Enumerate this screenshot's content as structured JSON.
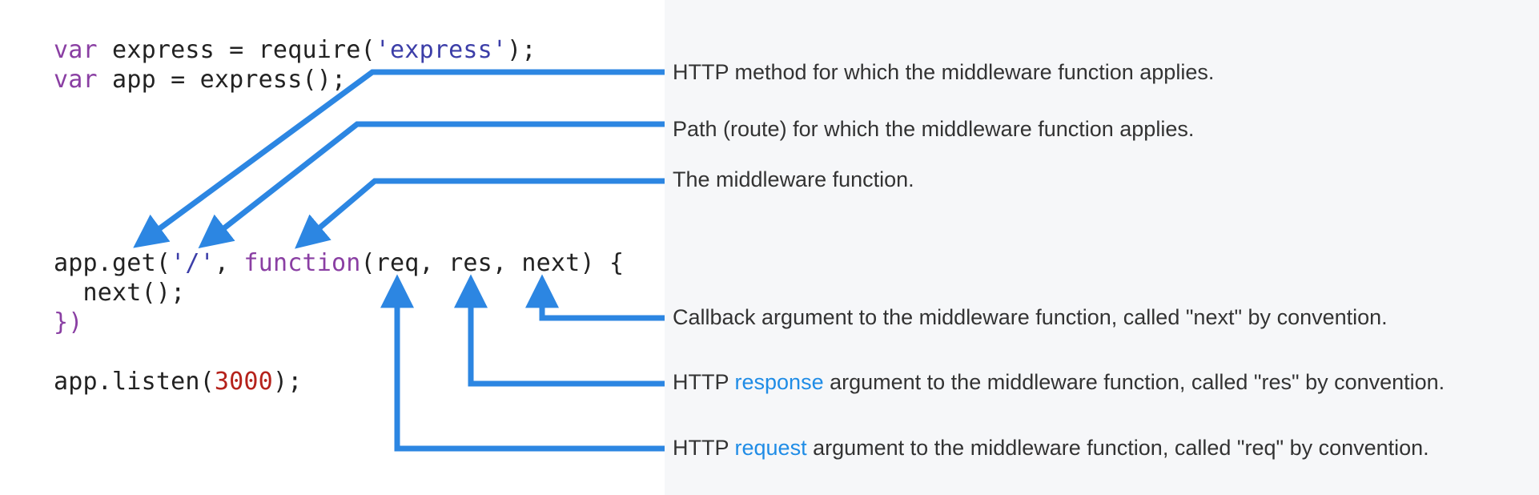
{
  "code": {
    "line1": {
      "kw": "var",
      "rest": " express = require(",
      "str": "'express'",
      "end": ");"
    },
    "line2": {
      "kw": "var",
      "rest": " app = express();"
    },
    "line3": {
      "pre": "app.get(",
      "str": "'/'",
      "comma": ", ",
      "kw": "function",
      "args": "(req, res, next) {"
    },
    "line4": "  next();",
    "line5": "})",
    "line6": {
      "pre": "app.listen(",
      "num": "3000",
      "end": ");"
    }
  },
  "annotations": {
    "method": "HTTP method for which the middleware function applies.",
    "path": "Path (route) for which the middleware function applies.",
    "middleware": "The middleware function.",
    "next": "Callback argument to the middleware function, called \"next\" by convention.",
    "response": {
      "prefix": "HTTP ",
      "link": "response",
      "suffix": " argument to the middleware function, called \"res\" by convention."
    },
    "request": {
      "prefix": "HTTP ",
      "link": "request",
      "suffix": " argument to the middleware function, called \"req\" by convention."
    }
  },
  "colors": {
    "arrow": "#2c86e2",
    "link": "#1f8ce6",
    "keyword": "#8a3fa3",
    "string": "#3c3ea8",
    "number": "#b5221b"
  }
}
